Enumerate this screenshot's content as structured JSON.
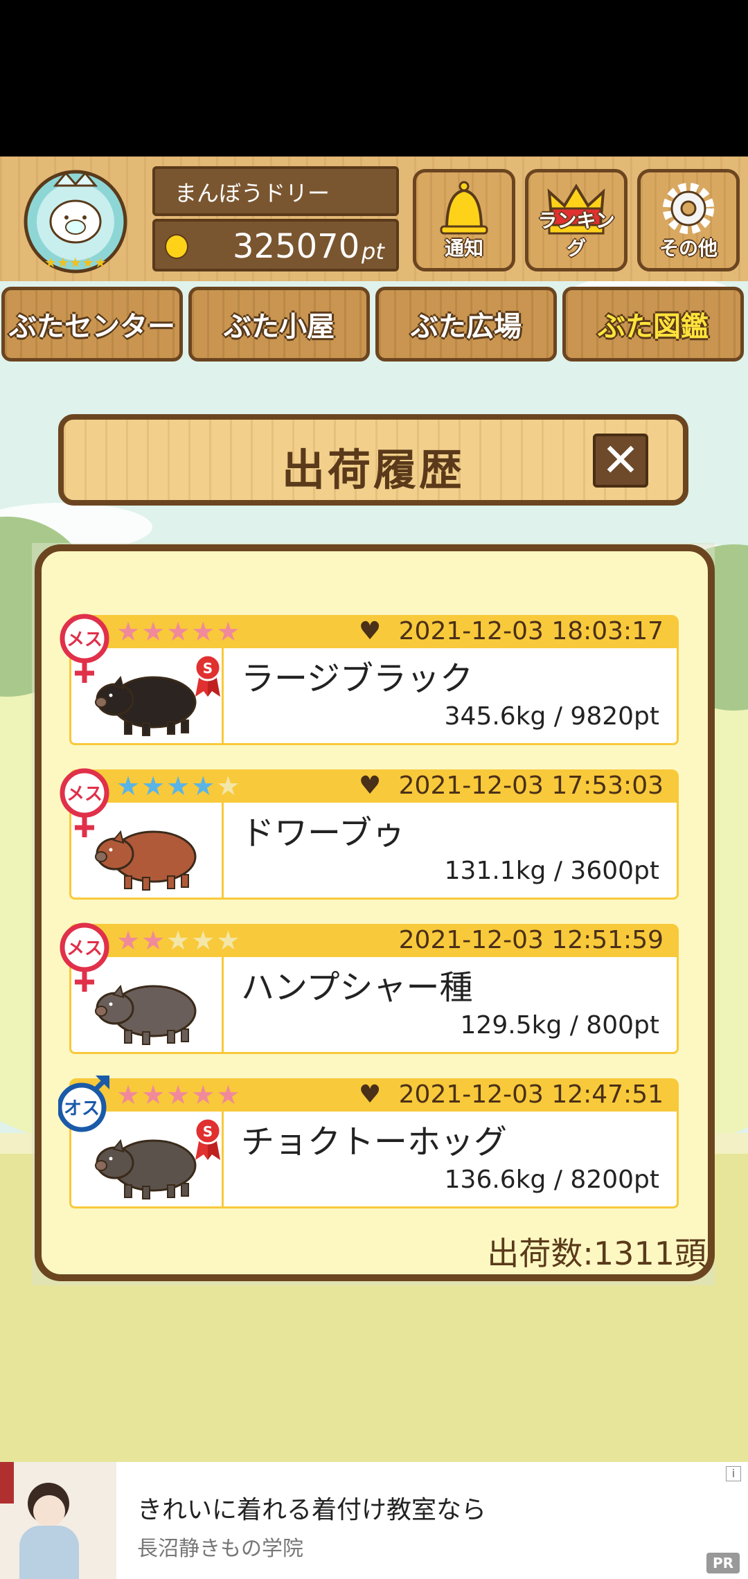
{
  "header": {
    "username": "まんぼうドリー",
    "points_value": "325070",
    "points_unit": "pt",
    "buttons": [
      {
        "label": "通知",
        "icon": "bell-icon"
      },
      {
        "label": "ランキング",
        "icon": "crown-icon"
      },
      {
        "label": "その他",
        "icon": "gear-icon"
      }
    ]
  },
  "nav": {
    "tabs": [
      {
        "label": "ぶたセンター",
        "active": false
      },
      {
        "label": "ぶた小屋",
        "active": false
      },
      {
        "label": "ぶた広場",
        "active": false
      },
      {
        "label": "ぶた図鑑",
        "active": true
      }
    ]
  },
  "dialog": {
    "title": "出荷履歴",
    "close_label": "✕",
    "count_text": "出荷数:1311頭",
    "records": [
      {
        "gender": "メス",
        "stars": 5,
        "star_color": "#f08a9a",
        "favorite": true,
        "date": "2021-12-03 18:03:17",
        "name": "ラージブラック",
        "weight_pt": "345.6kg / 9820pt",
        "ribbon": "S",
        "pig_color": "#2b2420"
      },
      {
        "gender": "メス",
        "stars": 4,
        "star_color": "#5ab4e6",
        "favorite": true,
        "date": "2021-12-03 17:53:03",
        "name": "ドワーブゥ",
        "weight_pt": "131.1kg / 3600pt",
        "ribbon": "",
        "pig_color": "#b05a3a"
      },
      {
        "gender": "メス",
        "stars": 2,
        "star_color": "#f08a9a",
        "favorite": false,
        "date": "2021-12-03 12:51:59",
        "name": "ハンプシャー種",
        "weight_pt": "129.5kg / 800pt",
        "ribbon": "",
        "pig_color": "#6a5e5a"
      },
      {
        "gender": "オス",
        "stars": 5,
        "star_color": "#f08a9a",
        "favorite": true,
        "date": "2021-12-03 12:47:51",
        "name": "チョクトーホッグ",
        "weight_pt": "136.6kg / 8200pt",
        "ribbon": "S",
        "pig_color": "#5b524c"
      }
    ]
  },
  "ad": {
    "title": "きれいに着れる着付け教室なら",
    "sponsor": "長沼静きもの学院",
    "pr_label": "PR",
    "info_label": "i"
  }
}
